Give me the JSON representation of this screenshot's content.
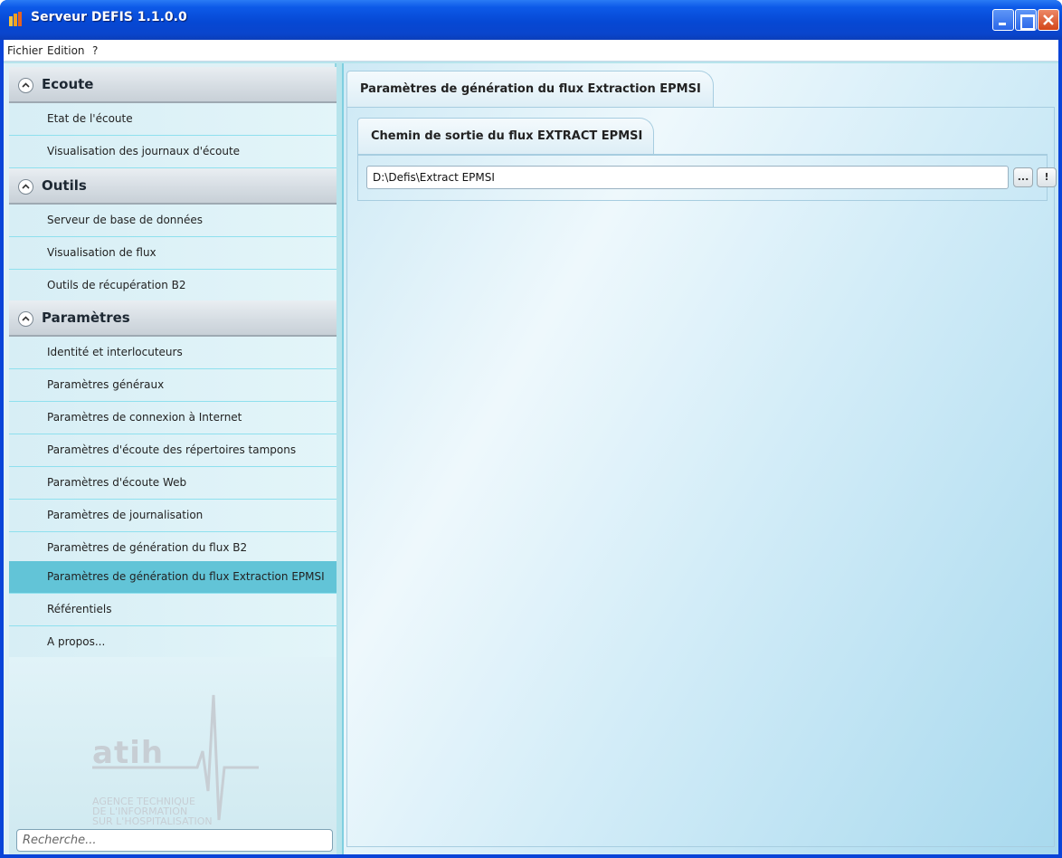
{
  "window": {
    "title": "Serveur DEFIS 1.1.0.0"
  },
  "menu": [
    "Fichier",
    "Edition",
    "?"
  ],
  "sidebar": {
    "groups": [
      {
        "title": "Ecoute",
        "items": [
          "Etat de l'écoute",
          "Visualisation des journaux d'écoute"
        ]
      },
      {
        "title": "Outils",
        "items": [
          "Serveur de base de données",
          "Visualisation de flux",
          "Outils de récupération B2"
        ]
      },
      {
        "title": "Paramètres",
        "items": [
          "Identité et interlocuteurs",
          "Paramètres généraux",
          "Paramètres de connexion à Internet",
          "Paramètres d'écoute des répertoires tampons",
          "Paramètres d'écoute Web",
          "Paramètres de journalisation",
          "Paramètres de génération du flux B2",
          "Paramètres de génération du flux Extraction EPMSI",
          "Référentiels",
          "A propos..."
        ]
      }
    ],
    "selected_item": "Paramètres de génération du flux Extraction EPMSI",
    "logo": {
      "word": "atih",
      "subtitle": [
        "AGENCE TECHNIQUE",
        "DE L'INFORMATION",
        "SUR L'HOSPITALISATION"
      ]
    },
    "search_placeholder": "Recherche..."
  },
  "main": {
    "tab_title": "Paramètres de génération du flux Extraction EPMSI",
    "subtab_title": "Chemin de sortie du flux EXTRACT EPMSI",
    "path_value": "D:\\Defis\\Extract EPMSI",
    "browse_label": "...",
    "action_label": "!"
  },
  "colors": {
    "titlebar": "#0648d4",
    "selected_item": "#62c4d7",
    "sidebar_bg": "#dff1f6"
  }
}
